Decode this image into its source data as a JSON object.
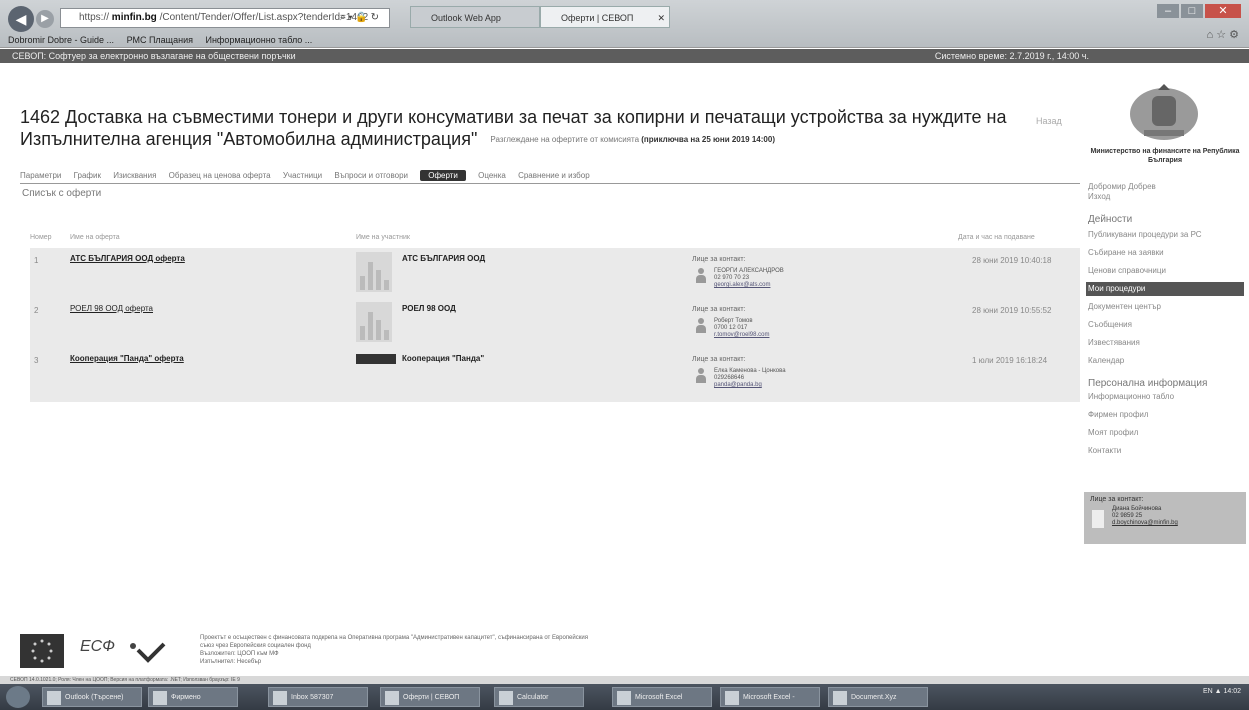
{
  "browser": {
    "url_prefix": "https://",
    "url_host": "minfin.bg",
    "url_path": "/Content/Tender/Offer/List.aspx?tenderId=1462",
    "addr_controls": "⌕ ▾ 🔒 ↻",
    "tabs": [
      "Outlook Web App",
      "Оферти | СЕВОП"
    ],
    "favorites": [
      "Dobromir Dobre - Guide ...",
      "РМС Плащания",
      "Информационно табло ..."
    ]
  },
  "sitebar": {
    "title": "СЕВОП: Софтуер за електронно възлагане на обществени поръчки",
    "time": "Системно време: 2.7.2019 г., 14:00 ч."
  },
  "page": {
    "title": "1462 Доставка на съвместими тонери и други консумативи за печат за копирни и печатащи устройства за нуждите на Изпълнителна агенция \"Автомобилна администрация\"",
    "subtitle": "Разглеждане на офертите от комисията",
    "subtitle_date": "(приключва на 25 юни 2019 14:00)",
    "back": "Назад",
    "tabs": [
      "Параметри",
      "График",
      "Изисквания",
      "Образец на ценова оферта",
      "Участници",
      "Въпроси и отговори",
      "Оферти",
      "Оценка",
      "Сравнение и избор"
    ],
    "active_tab": "Оферти",
    "list_title": "Списък с оферти"
  },
  "table": {
    "headers": [
      "Номер",
      "Име на оферта",
      "Име на участник",
      "Дата и час на подаване"
    ],
    "rows": [
      {
        "num": "1",
        "offer": "АТС БЪЛГАРИЯ ООД оферта",
        "company": "АТС БЪЛГАРИЯ ООД",
        "contact_label": "Лице за контакт:",
        "contact_name": "ГЕОРГИ АЛЕКСАНДРОВ",
        "contact_phone": "02 970 70 23",
        "contact_email": "georgi.alex@ats.com",
        "date": "28 юни 2019 10:40:18"
      },
      {
        "num": "2",
        "offer": "РОЕЛ 98 ООД оферта",
        "company": "РОЕЛ 98 ООД",
        "contact_label": "Лице за контакт:",
        "contact_name": "Роберт Томов",
        "contact_phone": "0700 12 017",
        "contact_email": "r.tomov@roel98.com",
        "date": "28 юни 2019 10:55:52"
      },
      {
        "num": "3",
        "offer": "Кооперация \"Панда\" оферта",
        "company": "Кооперация \"Панда\"",
        "contact_label": "Лице за контакт:",
        "contact_name": "Елка Каменова - Цонкова",
        "contact_phone": "029268646",
        "contact_email": "panda@panda.bg",
        "date": "1 юли 2019 16:18:24"
      }
    ]
  },
  "sidebar": {
    "ministry": "Министерство на финансите на Република България",
    "user_name": "Добромир Добрев",
    "user_logout": "Изход",
    "section_activities": "Дейности",
    "activities": [
      "Публикувани процедури за РС",
      "Събиране на заявки",
      "Ценови справочници",
      "Мои процедури",
      "Документен център",
      "Съобщения",
      "Известявания",
      "Календар"
    ],
    "active_item": "Мои процедури",
    "section_personal": "Персонална информация",
    "personal": [
      "Информационно табло",
      "Фирмен профил",
      "Моят профил",
      "Контакти"
    ],
    "contact_label": "Лице за контакт:",
    "contact_name": "Диана Бойчинова",
    "contact_phone": "02 9859 25",
    "contact_email": "d.boychinova@minfin.bg"
  },
  "footer": {
    "esf": "ЕСФ",
    "lines": [
      "Проектът е осъществен с финансовата подкрепа на Оперативна програма \"Административен капацитет\", съфинансирана от Европейския",
      "съюз чрез Европейския социален фонд",
      "Възложител: ЦООП към МФ",
      "Изпълнител: Несебър"
    ],
    "status": "СЕВОП 14.0.1021.0; Роля: Член на ЦООП; Версия на платформата: .NET; Използван браузър: IE 9"
  },
  "taskbar": {
    "items": [
      "Outlook (Търсене)",
      "Фирмено",
      "Inbox 587307",
      "Оферти | СЕВОП",
      "Calculator",
      "Microsoft Excel",
      "Microsoft Excel -",
      "Document.Xyz"
    ],
    "tray": "EN ▲ 14:02"
  }
}
